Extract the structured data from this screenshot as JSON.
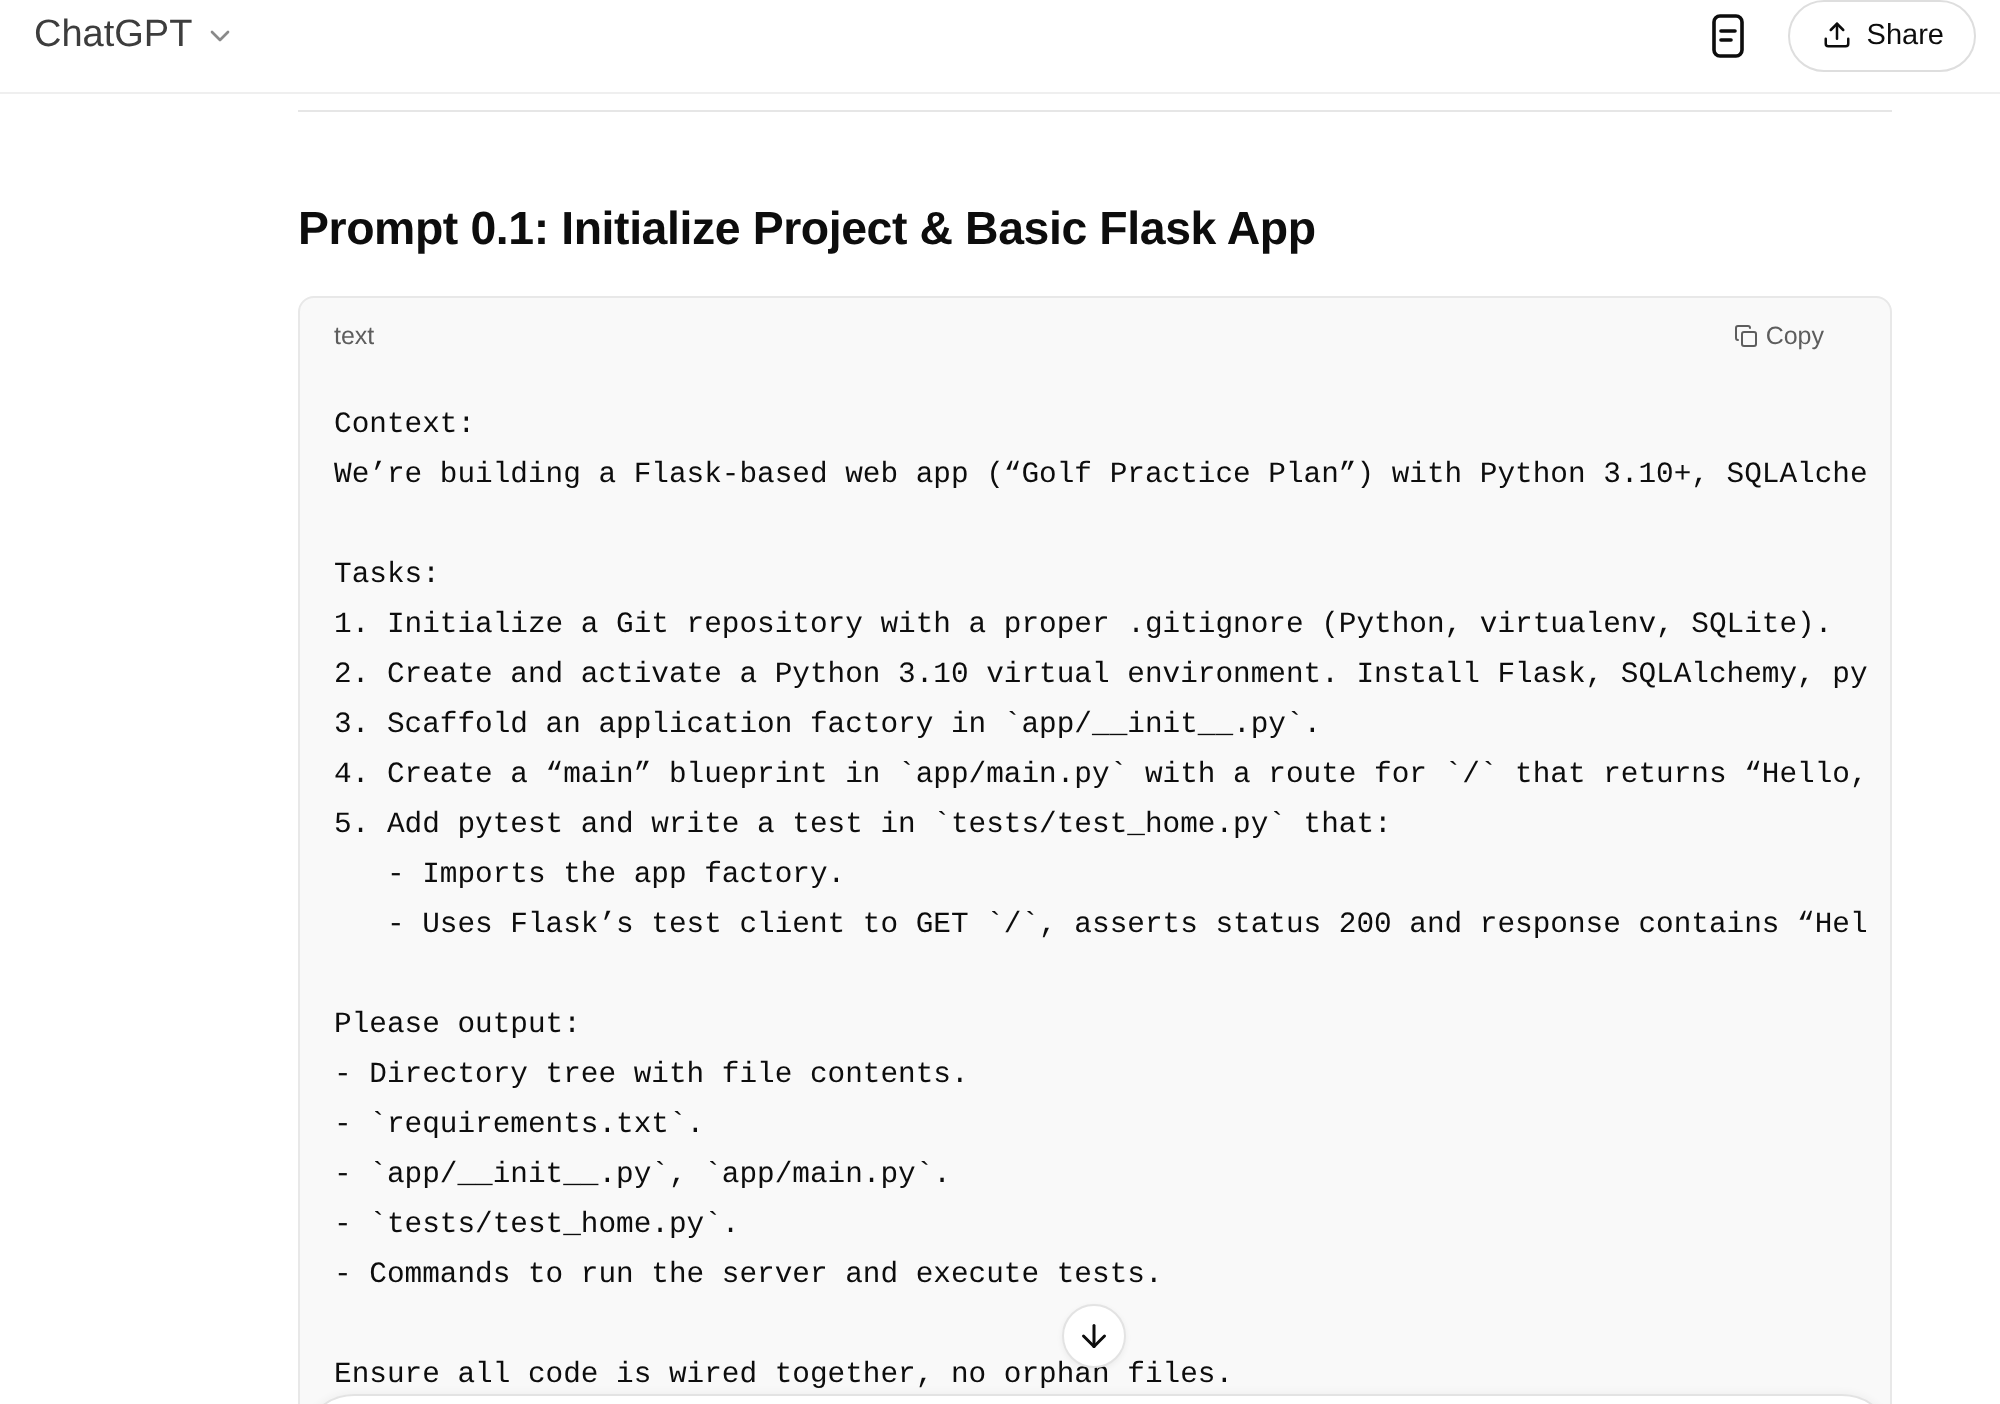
{
  "header": {
    "title": "ChatGPT",
    "share_label": "Share"
  },
  "message": {
    "heading": "Prompt 0.1: Initialize Project & Basic Flask App",
    "code_block": {
      "language": "text",
      "copy_label": "Copy",
      "paragraphs": [
        [
          "Context:",
          "We’re building a Flask-based web app (“Golf Practice Plan”) with Python 3.10+, SQLAlche"
        ],
        [
          "Tasks:",
          "1. Initialize a Git repository with a proper .gitignore (Python, virtualenv, SQLite).",
          "2. Create and activate a Python 3.10 virtual environment. Install Flask, SQLAlchemy, py",
          "3. Scaffold an application factory in `app/__init__.py`.",
          "4. Create a “main” blueprint in `app/main.py` with a route for `/` that returns “Hello,",
          "5. Add pytest and write a test in `tests/test_home.py` that:",
          "   - Imports the app factory.",
          "   - Uses Flask’s test client to GET `/`, asserts status 200 and response contains “Hel"
        ],
        [
          "Please output:",
          "- Directory tree with file contents.",
          "- `requirements.txt`.",
          "- `app/__init__.py`, `app/main.py`.",
          "- `tests/test_home.py`.",
          "- Commands to run the server and execute tests."
        ],
        [
          "Ensure all code is wired together, no orphan files."
        ]
      ]
    }
  }
}
